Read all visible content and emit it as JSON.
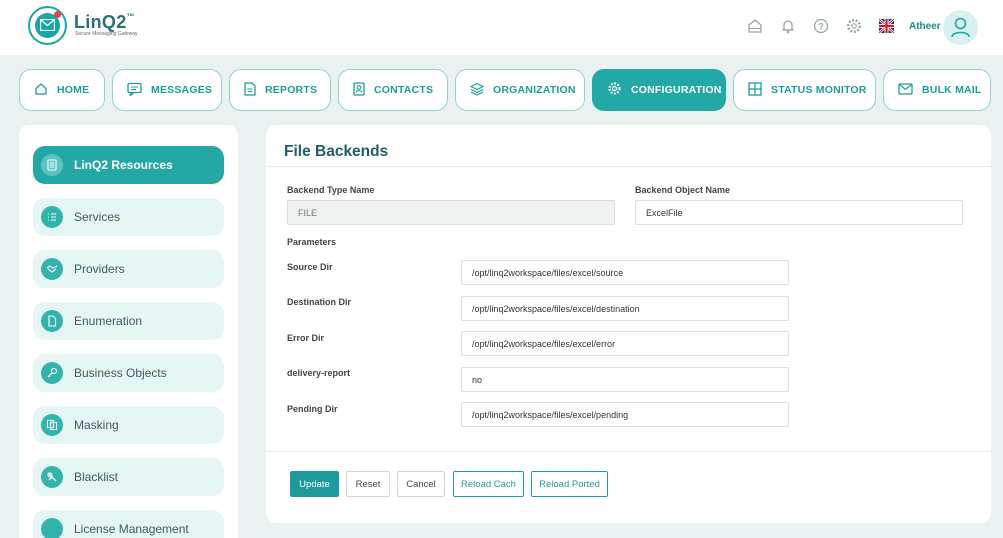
{
  "brand": {
    "name": "LinQ2",
    "superscript": "™",
    "tagline": "Secure Messaging Gateway",
    "color": "#1aa6a6"
  },
  "header": {
    "user_name": "Atheer",
    "icons": [
      "home-icon",
      "bell-icon",
      "help-icon",
      "gear-icon",
      "uk-flag-icon",
      "user-avatar-icon"
    ]
  },
  "nav": {
    "tabs": [
      {
        "label": "HOME",
        "icon": "home-icon"
      },
      {
        "label": "MESSAGES",
        "icon": "message-icon"
      },
      {
        "label": "REPORTS",
        "icon": "document-icon"
      },
      {
        "label": "CONTACTS",
        "icon": "contact-icon"
      },
      {
        "label": "ORGANIZATION",
        "icon": "layers-icon"
      },
      {
        "label": "CONFIGURATION",
        "icon": "gear-icon",
        "active": true
      },
      {
        "label": "STATUS MONITOR",
        "icon": "grid-icon"
      },
      {
        "label": "BULK MAIL",
        "icon": "mail-icon"
      }
    ]
  },
  "sidebar": {
    "items": [
      {
        "label": "LinQ2 Resources",
        "active": true
      },
      {
        "label": "Services"
      },
      {
        "label": "Providers"
      },
      {
        "label": "Enumeration"
      },
      {
        "label": "Business Objects"
      },
      {
        "label": "Masking"
      },
      {
        "label": "Blacklist"
      },
      {
        "label": "License Management"
      }
    ]
  },
  "form": {
    "title": "File Backends",
    "backend_type_label": "Backend Type Name",
    "backend_type_value": "FILE",
    "backend_object_label": "Backend Object Name",
    "backend_object_value": "ExcelFile",
    "parameters_label": "Parameters",
    "params": [
      {
        "label": "Source Dir",
        "value": "/opt/linq2workspace/files/excel/source"
      },
      {
        "label": "Destination Dir",
        "value": "/opt/linq2workspace/files/excel/destination"
      },
      {
        "label": "Error Dir",
        "value": "/opt/linq2workspace/files/excel/error"
      },
      {
        "label": "delivery-report",
        "value": "no"
      },
      {
        "label": "Pending Dir",
        "value": "/opt/linq2workspace/files/excel/pending"
      }
    ]
  },
  "buttons": {
    "update": "Update",
    "reset": "Reset",
    "cancel": "Cancel",
    "reload_cach": "Reload Cach",
    "reload_ported": "Reload Ported"
  },
  "colors": {
    "accent": "#23a9a5",
    "background": "#e9f1f1",
    "sidebar_item": "#e5f6f5"
  }
}
